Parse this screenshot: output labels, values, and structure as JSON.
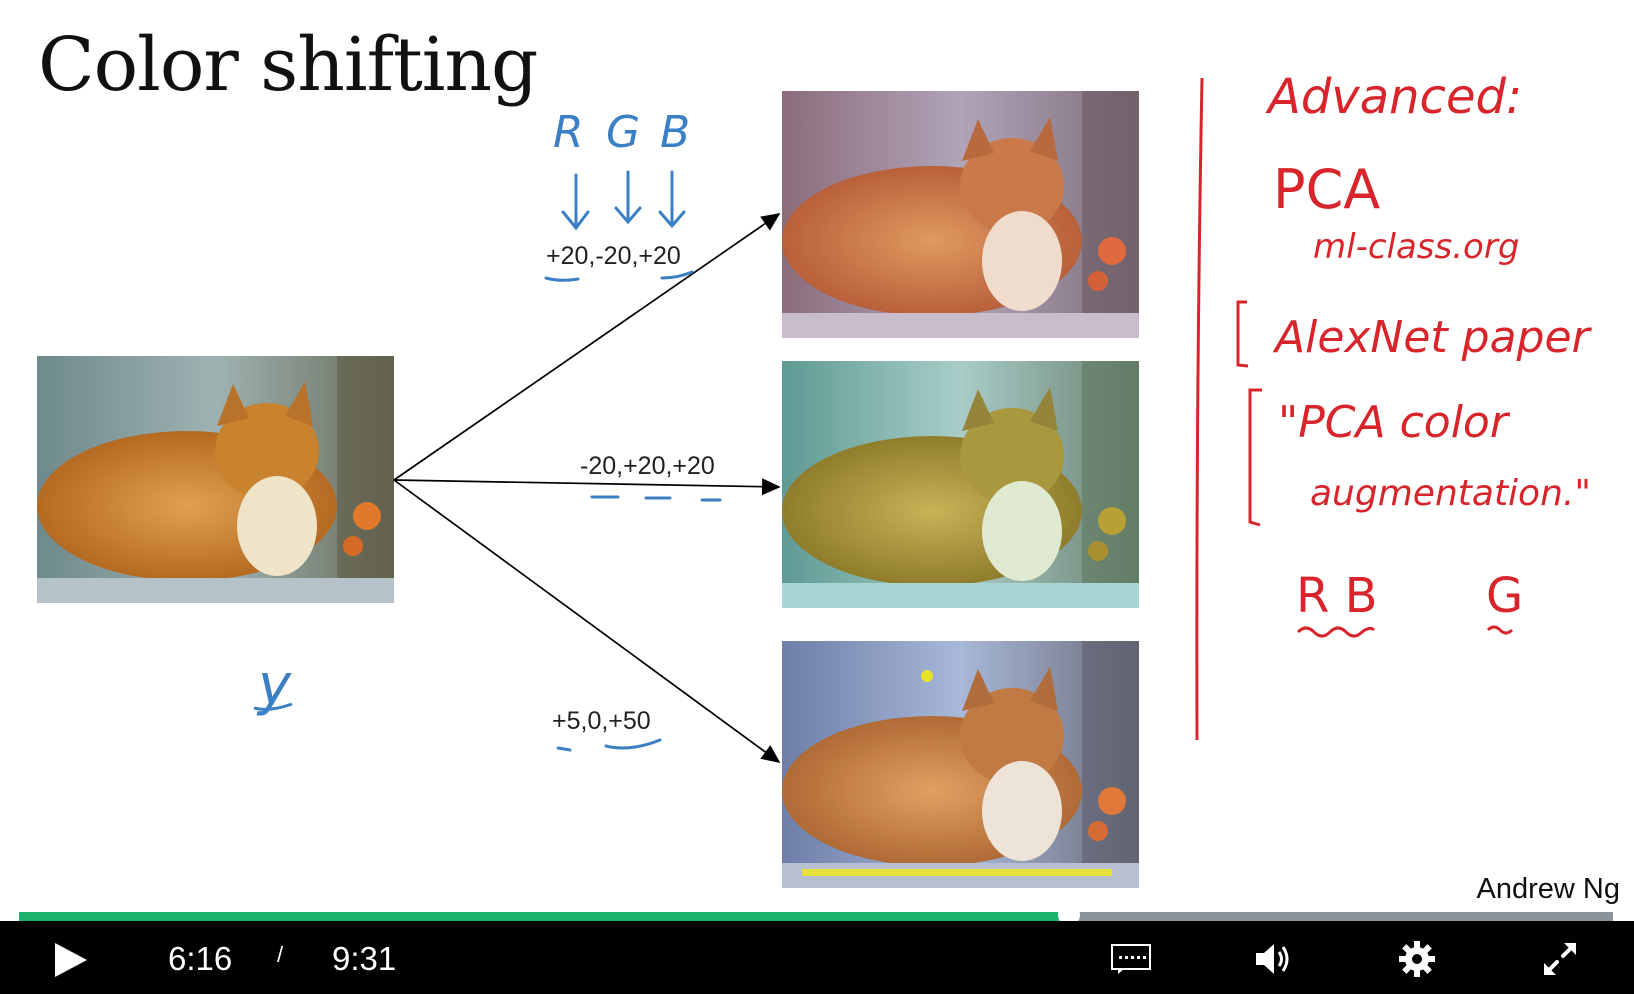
{
  "slide": {
    "title": "Color shifting",
    "author": "Andrew Ng",
    "ops": [
      "+20,-20,+20",
      "-20,+20,+20",
      "+5,0,+50"
    ],
    "channels": [
      "R",
      "G",
      "B"
    ],
    "y_label": "y",
    "notes": {
      "advanced": "Advanced:",
      "pca": "PCA",
      "ml_class": "ml-class.org",
      "alexnet": "AlexNet paper",
      "pca_color_1": "\"PCA color",
      "pca_color_2": "augmentation.\"",
      "rb": "R B",
      "g": "G"
    }
  },
  "player": {
    "current_time": "6:16",
    "separator": "/",
    "duration": "9:31",
    "progress": 0.659,
    "accent": "#1bb26e"
  },
  "icons": [
    "play-icon",
    "captions-icon",
    "volume-icon",
    "settings-icon",
    "fullscreen-icon"
  ]
}
